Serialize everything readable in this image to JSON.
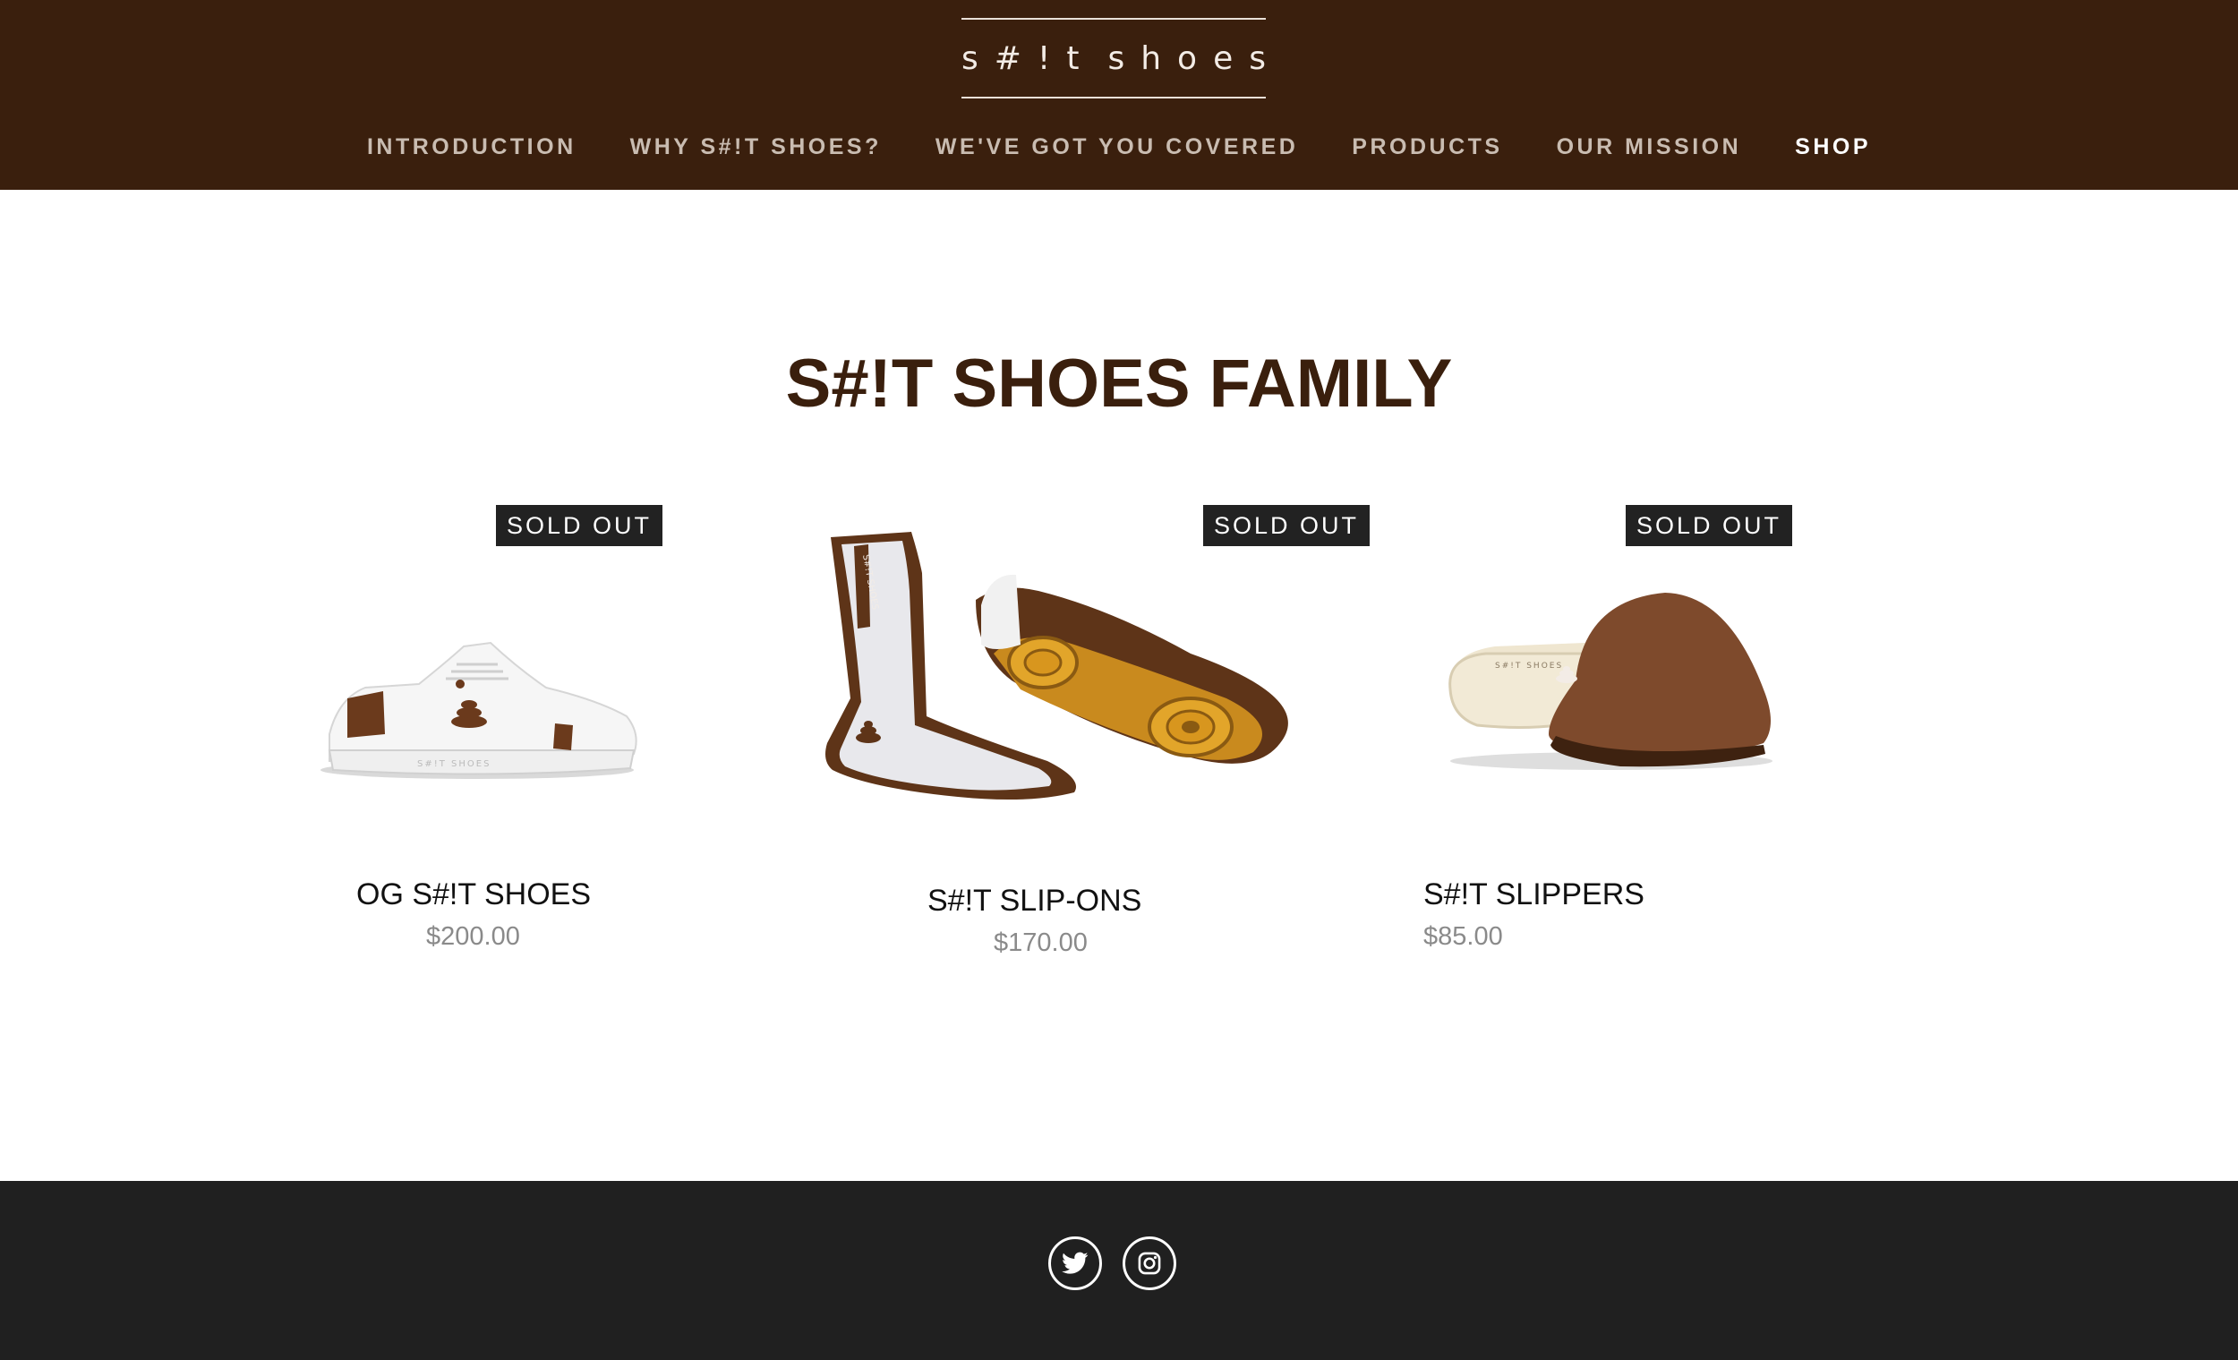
{
  "brand": {
    "logo_text": "s#!t shoes"
  },
  "nav": {
    "items": [
      {
        "label": "INTRODUCTION"
      },
      {
        "label": "WHY S#!T SHOES?"
      },
      {
        "label": "WE'VE GOT YOU COVERED"
      },
      {
        "label": "PRODUCTS"
      },
      {
        "label": "OUR MISSION"
      },
      {
        "label": "SHOP"
      }
    ],
    "active": "SHOP"
  },
  "main": {
    "title": "S#!T SHOES FAMILY",
    "products": [
      {
        "name": "OG S#!T SHOES",
        "price": "$200.00",
        "badge": "SOLD OUT",
        "image": "white-sneaker"
      },
      {
        "name": "S#!T SLIP-ONS",
        "price": "$170.00",
        "badge": "SOLD OUT",
        "image": "sock-slip-on"
      },
      {
        "name": "S#!T SLIPPERS",
        "price": "$85.00",
        "badge": "SOLD OUT",
        "image": "suede-slipper"
      }
    ]
  },
  "footer": {
    "social": [
      {
        "icon": "twitter-icon"
      },
      {
        "icon": "instagram-icon"
      }
    ]
  },
  "colors": {
    "header_bg": "#3a1f0d",
    "title_brown": "#3a1f0d",
    "accent_brown": "#6b3a1c",
    "footer_bg": "#202020",
    "badge_bg": "#222222"
  }
}
